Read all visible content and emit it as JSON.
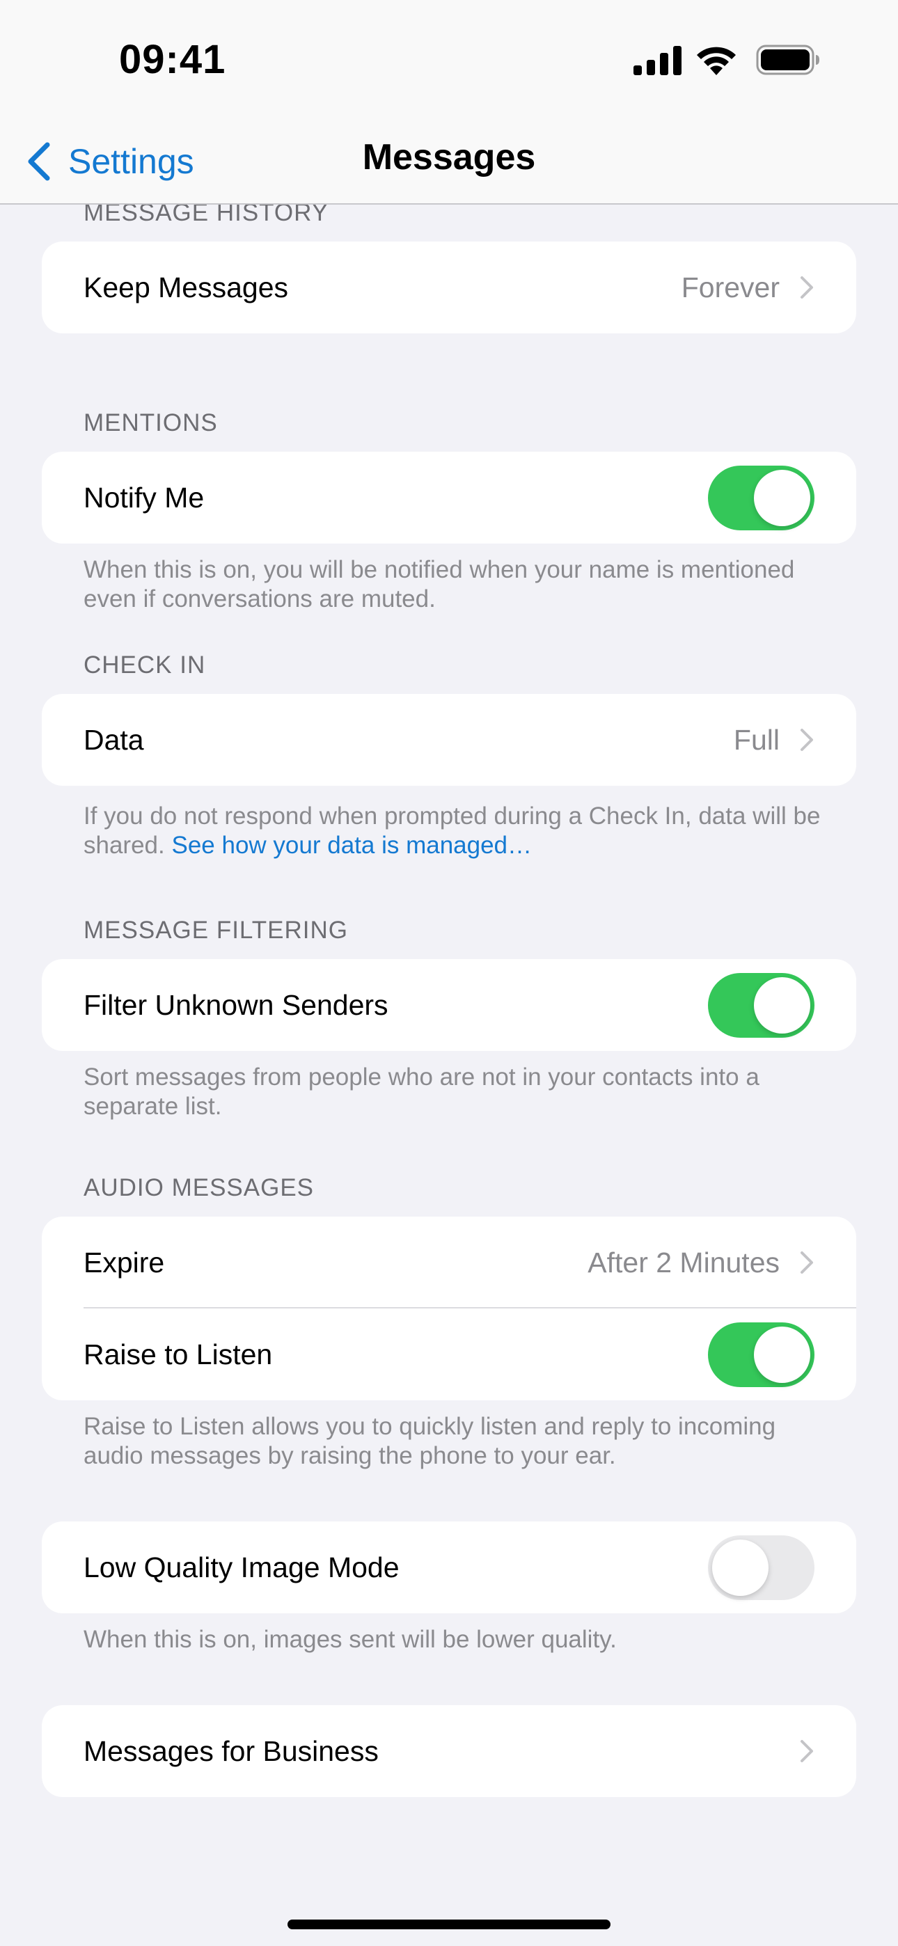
{
  "status_bar": {
    "time": "09:41",
    "signal_icon": "cellular-signal-icon",
    "wifi_icon": "wifi-icon",
    "battery_icon": "battery-full-icon"
  },
  "nav": {
    "back_label": "Settings",
    "title": "Messages"
  },
  "sections": {
    "history": {
      "header": "MESSAGE HISTORY",
      "keep_messages": {
        "label": "Keep Messages",
        "value": "Forever"
      }
    },
    "mentions": {
      "header": "MENTIONS",
      "notify_me": {
        "label": "Notify Me",
        "on": true
      },
      "footer": "When this is on, you will be notified when your name is mentioned even if conversations are muted."
    },
    "check_in": {
      "header": "CHECK IN",
      "data": {
        "label": "Data",
        "value": "Full"
      },
      "footer_text": "If you do not respond when prompted during a Check In, data will be shared.",
      "footer_link": "See how your data is managed…"
    },
    "filtering": {
      "header": "MESSAGE FILTERING",
      "filter_unknown": {
        "label": "Filter Unknown Senders",
        "on": true
      },
      "footer": "Sort messages from people who are not in your contacts into a separate list."
    },
    "audio": {
      "header": "AUDIO MESSAGES",
      "expire": {
        "label": "Expire",
        "value": "After 2 Minutes"
      },
      "raise_to_listen": {
        "label": "Raise to Listen",
        "on": true
      },
      "footer": "Raise to Listen allows you to quickly listen and reply to incoming audio messages by raising the phone to your ear."
    },
    "low_quality": {
      "label": "Low Quality Image Mode",
      "on": false,
      "footer": "When this is on, images sent will be lower quality."
    },
    "business": {
      "label": "Messages for Business"
    }
  },
  "colors": {
    "accent": "#1479d1",
    "toggle_on": "#34c759",
    "toggle_off": "#e9e9eb",
    "background": "#f2f2f7"
  }
}
